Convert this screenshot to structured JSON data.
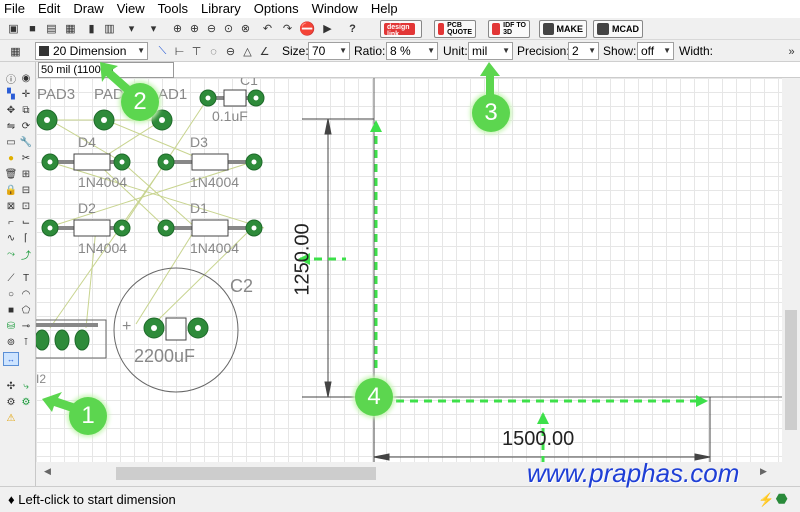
{
  "menu": [
    "File",
    "Edit",
    "Draw",
    "View",
    "Tools",
    "Library",
    "Options",
    "Window",
    "Help"
  ],
  "toolbar1": {
    "brand_buttons": [
      "design link",
      "PCB QUOTE",
      "IDF TO 3D",
      "MAKE",
      "MCAD"
    ],
    "colors": {
      "design_link": "#e23636",
      "pcb_quote": "#e23636",
      "idf": "#e23636"
    }
  },
  "toolbar2": {
    "layer": "20 Dimension",
    "size_label": "Size:",
    "size_value": "70",
    "ratio_label": "Ratio:",
    "ratio_value": "8 %",
    "unit_label": "Unit:",
    "unit_value": "mil",
    "precision_label": "Precision:",
    "precision_value": "2",
    "show_label": "Show:",
    "show_value": "off",
    "width_label": "Width:"
  },
  "grid": {
    "field": "50 mil (1100 0)"
  },
  "canvas": {
    "labels": {
      "pad3": "PAD3",
      "pad2": "PAD",
      "pad1": "AD1",
      "c1": "C1",
      "c1_value": "0.1uF",
      "d4": "D4",
      "d3": "D3",
      "d2": "D2",
      "d1": "D1",
      "diode_value": "1N4004",
      "c2": "C2",
      "c2_value": "2200uF",
      "plus": "+",
      "ic_name": "I2"
    },
    "dimension_vertical": "1250.00",
    "dimension_horizontal": "1500.00",
    "colors": {
      "pad": "#2e8b3a",
      "trace": "#c8d48f",
      "board_outline": "#666666",
      "arrow": "#3de04a",
      "grid_line": "#e6e6e6"
    }
  },
  "callouts": [
    "1",
    "2",
    "3",
    "4"
  ],
  "status": {
    "text": "♦ Left-click to start dimension"
  },
  "watermark": "www.praphas.com"
}
